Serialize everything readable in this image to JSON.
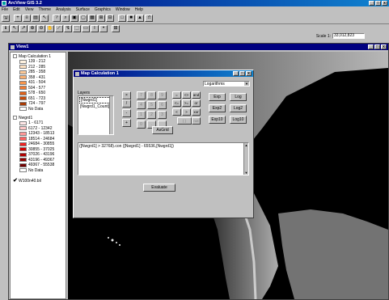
{
  "app": {
    "title": "ArcView GIS 3.2",
    "caption_buttons": [
      "_",
      "□",
      "x"
    ]
  },
  "menu": [
    {
      "label": "File"
    },
    {
      "label": "Edit"
    },
    {
      "label": "View"
    },
    {
      "label": "Theme"
    },
    {
      "label": "Analysis"
    },
    {
      "label": "Surface"
    },
    {
      "label": "Graphics"
    },
    {
      "label": "Window"
    },
    {
      "label": "Help"
    }
  ],
  "toolbar1": [
    "save-icon",
    "add-theme-icon",
    "theme-properties-icon",
    "edit-legend-icon",
    "pointer-icon",
    "query-icon",
    "find-icon",
    "zoom-full-icon",
    "zoom-active-icon",
    "zoom-selected-icon",
    "zoom-in-icon",
    "zoom-out-icon",
    "clear-icon",
    "select-icon",
    "layout-icon",
    "help-icon"
  ],
  "toolbar2": [
    "identify-icon",
    "pointer-icon",
    "vertex-icon",
    "zoom-in-tool-icon",
    "zoom-out-tool-icon",
    "pan-icon",
    "measure-icon",
    "hotlink-icon",
    "area-select-icon",
    "label-icon",
    "text-icon",
    "draw-icon",
    "snap-icon"
  ],
  "scale": {
    "label": "Scale 1:",
    "value": "33,012,823"
  },
  "view": {
    "title": "View1"
  },
  "toc": {
    "themes": [
      {
        "name": "Map Calculation 1",
        "checked": false,
        "legend": [
          {
            "label": "139 - 212",
            "color": "#fff2e0"
          },
          {
            "label": "212 - 285",
            "color": "#fde0c0"
          },
          {
            "label": "285 - 358",
            "color": "#fcc896"
          },
          {
            "label": "358 - 431",
            "color": "#fbb070"
          },
          {
            "label": "431 - 504",
            "color": "#f8954c"
          },
          {
            "label": "504 - 577",
            "color": "#f07a30"
          },
          {
            "label": "578 - 650",
            "color": "#e06018"
          },
          {
            "label": "651 - 723",
            "color": "#c84a08"
          },
          {
            "label": "724 - 797",
            "color": "#a83a04"
          },
          {
            "label": "No Data",
            "color": "#ffffff"
          }
        ]
      },
      {
        "name": "Nwgrd1",
        "checked": false,
        "legend": [
          {
            "label": "1 - 6171",
            "color": "#ffe8e8"
          },
          {
            "label": "6172 - 12342",
            "color": "#ffc8c8"
          },
          {
            "label": "12343 - 18513",
            "color": "#ff9898"
          },
          {
            "label": "18514 - 24684",
            "color": "#ff6060"
          },
          {
            "label": "24684 - 30855",
            "color": "#f02020"
          },
          {
            "label": "30855 - 37025",
            "color": "#d00000"
          },
          {
            "label": "37026 - 43196",
            "color": "#b00000"
          },
          {
            "label": "43196 - 49367",
            "color": "#900000"
          },
          {
            "label": "49367 - 55538",
            "color": "#700000"
          },
          {
            "label": "No Data",
            "color": "#ffffff"
          }
        ]
      },
      {
        "name": "W100n40.bil",
        "checked": true,
        "legend": []
      }
    ]
  },
  "dialog": {
    "title": "Map Calculation 1",
    "layers_label": "Layers",
    "layers": [
      "[Nwgrd1]",
      "[Nwgrd1_Count]"
    ],
    "keypad": {
      "ops": [
        "×",
        "/",
        "-",
        "+"
      ],
      "digits": [
        "7",
        "8",
        "9",
        "4",
        "5",
        "6",
        "1",
        "2",
        "3",
        "0",
        ".",
        " "
      ]
    },
    "logic_ops": [
      "=",
      "<>",
      "and",
      "<=",
      ">=",
      "or",
      "<",
      ">",
      "xor",
      "( )",
      "not"
    ],
    "dropdown": "Logarithms",
    "functions": [
      "Exp",
      "Log",
      "Exp2",
      "Log2",
      "Exp10",
      "Log10"
    ],
    "asgrid": "AsGrid",
    "expression": "([Nwgrd1] > 32768).con ([Nwgrd1] - 65536,[Nwgrd1])",
    "evaluate": "Evaluate"
  }
}
